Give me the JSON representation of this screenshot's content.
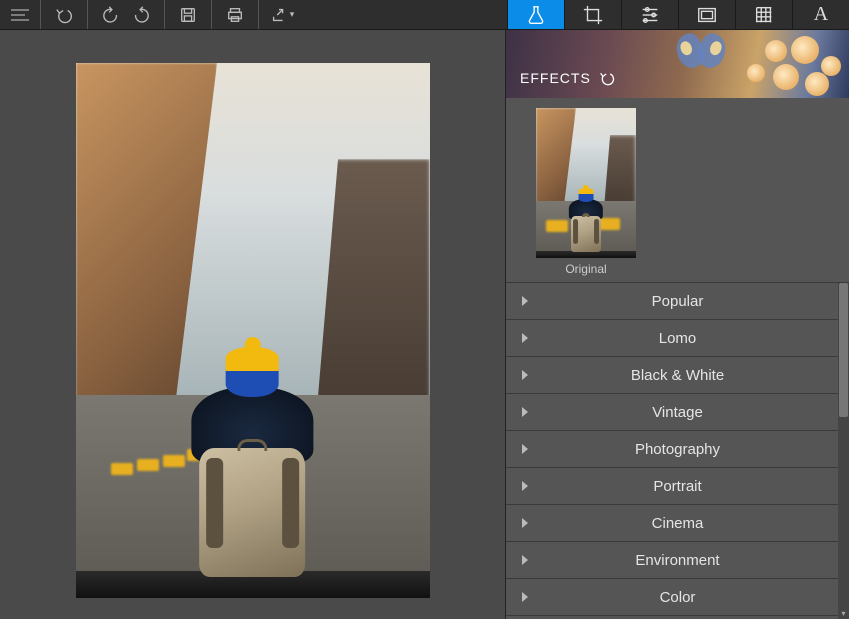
{
  "panel": {
    "effects_label": "EFFECTS",
    "thumb_label": "Original"
  },
  "categories": [
    "Popular",
    "Lomo",
    "Black & White",
    "Vintage",
    "Photography",
    "Portrait",
    "Cinema",
    "Environment",
    "Color"
  ],
  "tabs": {
    "text_glyph": "A"
  }
}
